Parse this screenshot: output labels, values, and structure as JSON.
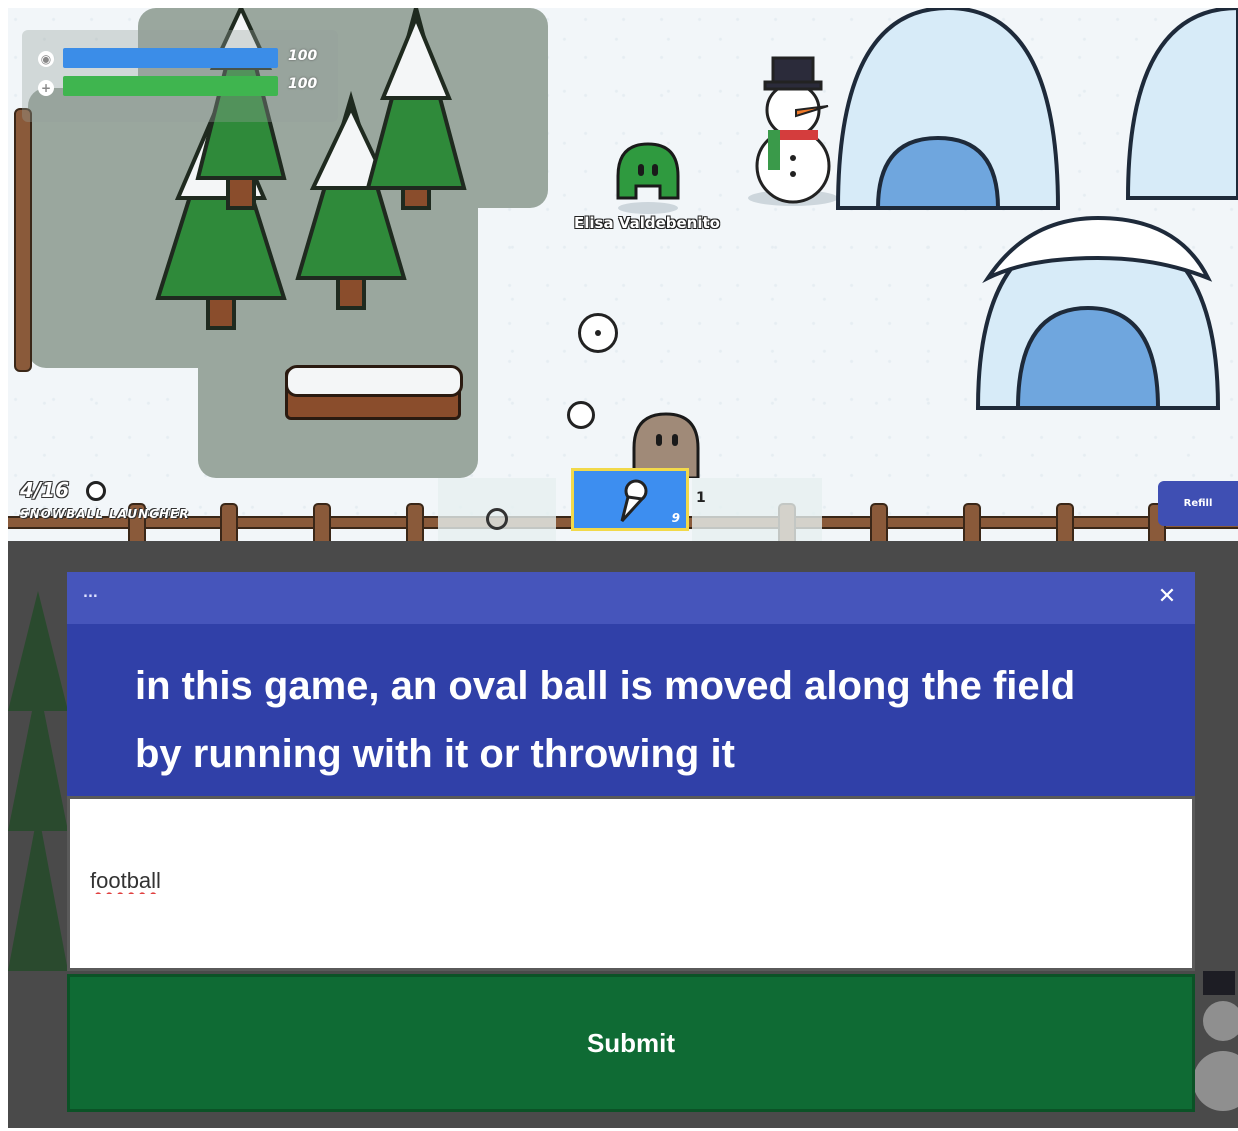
{
  "hud": {
    "shield_value": "100",
    "health_value": "100",
    "shield_color": "#3b8de8",
    "health_color": "#3fb54f",
    "ammo": "4/16",
    "weapon_name": "SNOWBALL LAUNCHER",
    "hotbar_count": "9",
    "hotbar_side_count": "1",
    "refill_label": "Refill"
  },
  "player": {
    "name": "Elisa Valdebenito"
  },
  "modal": {
    "menu_label": "...",
    "close_label": "✕",
    "question": "in this game, an oval ball is moved along the field by running with it or throwing it",
    "answer_value": "football",
    "submit_label": "Submit"
  },
  "colors": {
    "header": "#4655bb",
    "question_bg": "#3040a8",
    "submit_bg": "#0f6b34"
  }
}
